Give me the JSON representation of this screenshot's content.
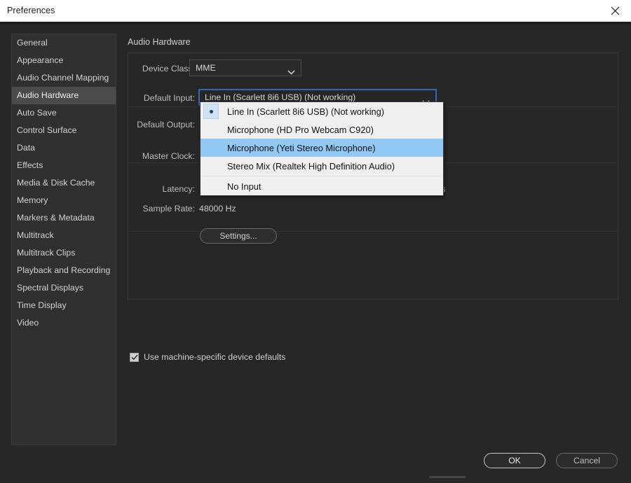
{
  "window": {
    "title": "Preferences",
    "close_icon": "close-icon"
  },
  "sidebar": {
    "items": [
      {
        "label": "General",
        "selected": false
      },
      {
        "label": "Appearance",
        "selected": false
      },
      {
        "label": "Audio Channel Mapping",
        "selected": false
      },
      {
        "label": "Audio Hardware",
        "selected": true
      },
      {
        "label": "Auto Save",
        "selected": false
      },
      {
        "label": "Control Surface",
        "selected": false
      },
      {
        "label": "Data",
        "selected": false
      },
      {
        "label": "Effects",
        "selected": false
      },
      {
        "label": "Media & Disk Cache",
        "selected": false
      },
      {
        "label": "Memory",
        "selected": false
      },
      {
        "label": "Markers & Metadata",
        "selected": false
      },
      {
        "label": "Multitrack",
        "selected": false
      },
      {
        "label": "Multitrack Clips",
        "selected": false
      },
      {
        "label": "Playback and Recording",
        "selected": false
      },
      {
        "label": "Spectral Displays",
        "selected": false
      },
      {
        "label": "Time Display",
        "selected": false
      },
      {
        "label": "Video",
        "selected": false
      }
    ]
  },
  "main": {
    "section_title": "Audio Hardware",
    "fields": {
      "device_class_label": "Device Class:",
      "device_class_value": "MME",
      "default_input_label": "Default Input:",
      "default_input_value": "Line In (Scarlett 8i6 USB) (Not working)",
      "default_output_label": "Default Output:",
      "master_clock_label": "Master Clock:",
      "latency_label": "Latency:",
      "latency_unit": "ms",
      "sample_rate_label": "Sample Rate:",
      "sample_rate_value": "48000 Hz"
    },
    "settings_button": "Settings...",
    "machine_defaults_label": "Use machine-specific device defaults",
    "machine_defaults_checked": true
  },
  "dropdown": {
    "open": true,
    "options": [
      {
        "label": "Line In (Scarlett 8i6 USB) (Not working)",
        "checked": true,
        "highlighted": false,
        "separator_after": false
      },
      {
        "label": "Microphone (HD Pro Webcam C920)",
        "checked": false,
        "highlighted": false,
        "separator_after": false
      },
      {
        "label": "Microphone (Yeti Stereo Microphone)",
        "checked": false,
        "highlighted": true,
        "separator_after": false
      },
      {
        "label": "Stereo Mix (Realtek High Definition Audio)",
        "checked": false,
        "highlighted": false,
        "separator_after": true
      },
      {
        "label": "No Input",
        "checked": false,
        "highlighted": false,
        "separator_after": false
      }
    ]
  },
  "footer": {
    "ok_label": "OK",
    "cancel_label": "Cancel"
  },
  "colors": {
    "window_bg": "#272727",
    "titlebar_bg": "#ffffff",
    "sidebar_bg": "#303030",
    "sidebar_selected": "#4b4b4b",
    "accent_focus": "#2b6cb8",
    "dropdown_bg": "#f0f0f0",
    "dropdown_highlight": "#92c8f4",
    "dropdown_check_bg": "#cfe3f5"
  }
}
